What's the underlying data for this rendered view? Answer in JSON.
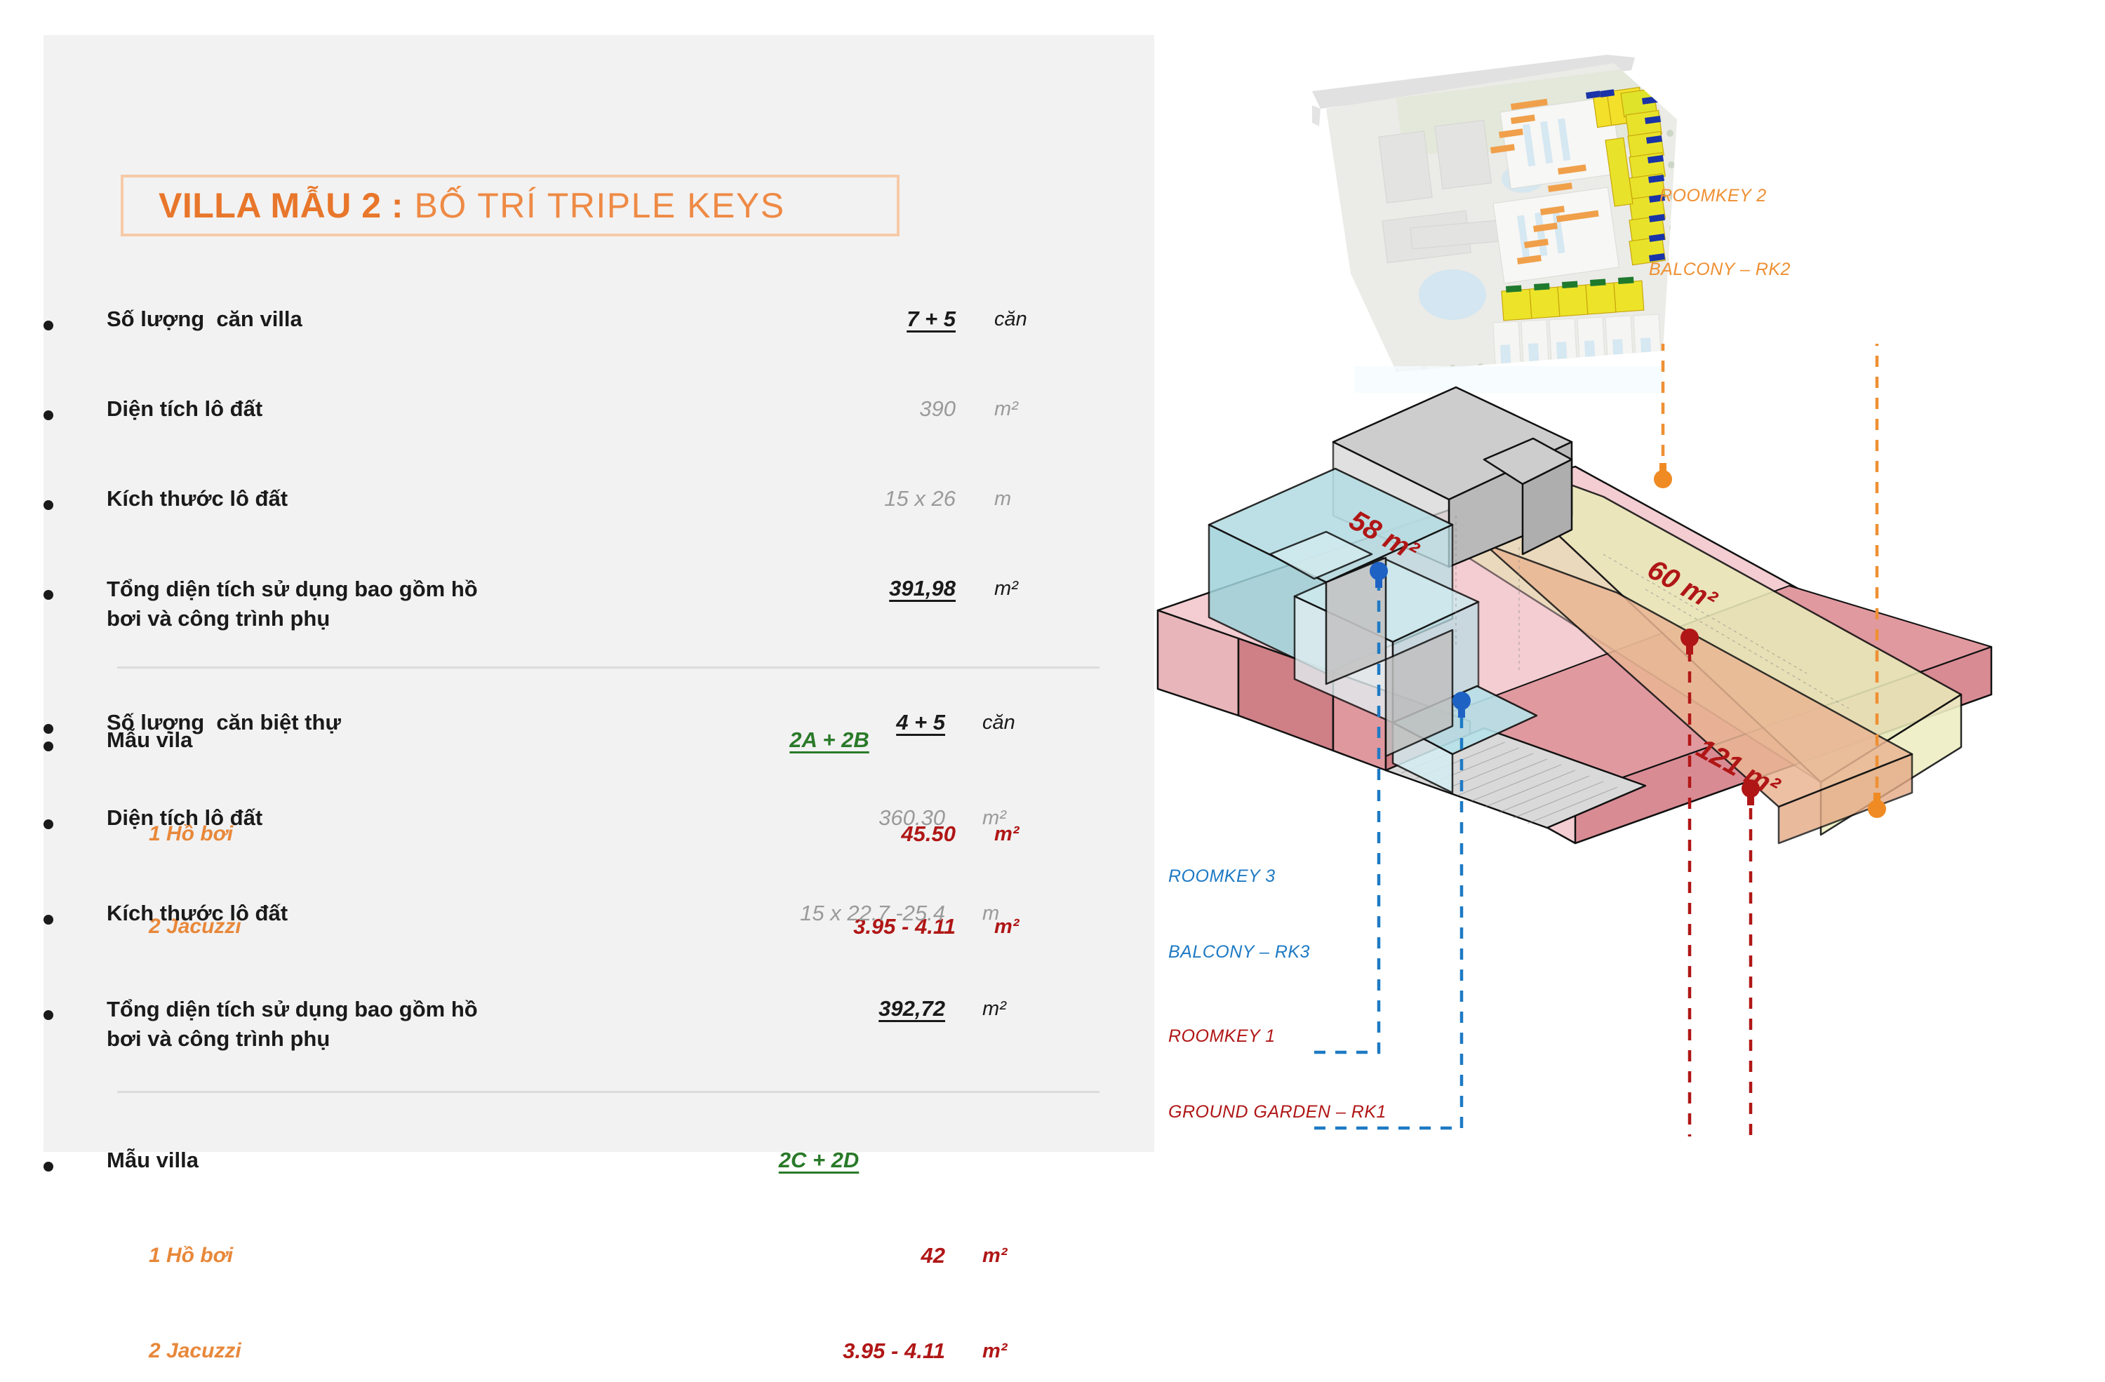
{
  "title": {
    "strong": "VILLA MẪU 2 :",
    "light": " BỐ TRÍ TRIPLE KEYS"
  },
  "blocks": [
    {
      "id": "villa-block",
      "rows": [
        {
          "label": "Số lượng  căn villa",
          "value": "7 + 5",
          "unit": "căn",
          "value_style": "strong",
          "unit_style": "dark"
        },
        {
          "label": "Diện tích lô đất",
          "value": "390",
          "unit": "m²",
          "value_style": "muted",
          "unit_style": "muted"
        },
        {
          "label": "Kích thước lô đất",
          "value": "15 x 26",
          "unit": "m",
          "value_style": "muted",
          "unit_style": "muted"
        },
        {
          "label": "Tổng diện tích sử dụng bao gồm hồ\nbơi và công trình phụ",
          "value": "391,98",
          "unit": "m²",
          "value_style": "strong",
          "unit_style": "dark"
        },
        {
          "label": "Mẫu vila",
          "value": "2A + 2B",
          "unit": "",
          "value_style": "green",
          "unit_style": "dark"
        }
      ],
      "subrows": [
        {
          "label": "1 Hồ bơi",
          "value": "45.50",
          "unit": "m²"
        },
        {
          "label": "2 Jacuzzi",
          "value": "3.95 - 4.11",
          "unit": "m²"
        }
      ]
    },
    {
      "id": "biet-thu-block",
      "rows": [
        {
          "label": "Số lượng  căn biệt thự",
          "value": "4 + 5",
          "unit": "căn",
          "value_style": "strong",
          "unit_style": "dark"
        },
        {
          "label": "Diện tích lô đất",
          "value": "360.30",
          "unit": "m²",
          "value_style": "muted",
          "unit_style": "muted"
        },
        {
          "label": "Kích thước lô đất",
          "value": "15 x 22.7 -25.4",
          "unit": "m",
          "value_style": "muted",
          "unit_style": "muted"
        },
        {
          "label": "Tổng diện tích sử dụng bao gồm hồ\nbơi và công trình phụ",
          "value": "392,72",
          "unit": "m²",
          "value_style": "strong",
          "unit_style": "dark"
        },
        {
          "label": "Mẫu villa",
          "value": "2C + 2D",
          "unit": "",
          "value_style": "green",
          "unit_style": "dark"
        }
      ],
      "subrows": [
        {
          "label": "1 Hồ bơi",
          "value": "42",
          "unit": "m²"
        },
        {
          "label": "2 Jacuzzi",
          "value": "3.95 - 4.11",
          "unit": "m²"
        }
      ]
    }
  ],
  "diagram": {
    "area_labels": [
      {
        "text": "58 m²",
        "color": "#b01616"
      },
      {
        "text": "60 m²",
        "color": "#b01616"
      },
      {
        "text": "121 m²",
        "color": "#b01616"
      }
    ],
    "callouts": [
      {
        "text": "ROOMKEY 2",
        "color": "#ef9033"
      },
      {
        "text": "BALCONY – RK2",
        "color": "#ef9033"
      },
      {
        "text": "ROOMKEY 3",
        "color": "#1e7ac4"
      },
      {
        "text": "BALCONY – RK3",
        "color": "#1e7ac4"
      },
      {
        "text": "ROOMKEY 1",
        "color": "#b01616"
      },
      {
        "text": "GROUND GARDEN – RK1",
        "color": "#b01616"
      }
    ]
  },
  "colors": {
    "accent_orange": "#e8762b",
    "panel_bg": "#f2f2f2",
    "green": "#2a7a29",
    "red": "#b01616",
    "blue": "#1e7ac4",
    "muted": "#9a9a9a"
  }
}
